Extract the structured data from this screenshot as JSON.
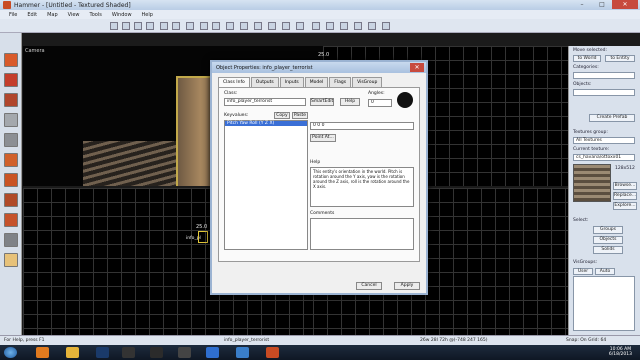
{
  "window": {
    "title": "Hammer - [Untitled - Textured Shaded]"
  },
  "menu": [
    "File",
    "Edit",
    "Map",
    "View",
    "Tools",
    "Window",
    "Help"
  ],
  "viewport3d": {
    "label": "Camera"
  },
  "grid_labels": {
    "top": "25.0",
    "left": "25.0",
    "cursor_tag": "info_pl"
  },
  "sidebar": {
    "move_selected": "Move selected:",
    "to_world": "to World",
    "to_entity": "to Entity",
    "categories_label": "Categories:",
    "objects_label": "Objects:",
    "create_prefab": "Create Prefab",
    "textures_group_label": "Textures group:",
    "textures_group_value": "All Textures",
    "current_texture_label": "Current texture:",
    "current_texture_value": "cs_havana/ottoxx01",
    "texture_size": "128x512",
    "browse": "Browse...",
    "replace": "Replace...",
    "explore": "Explore...",
    "select_label": "Select:",
    "groups": "Groups",
    "objects": "Objects",
    "solids": "Solids",
    "visgroups_label": "VisGroups:",
    "user": "User",
    "auto": "Auto"
  },
  "dialog": {
    "title": "Object Properties: info_player_terrorist",
    "tabs": [
      "Class Info",
      "Outputs",
      "Inputs",
      "Model",
      "Flags",
      "VisGroup"
    ],
    "class_label": "Class:",
    "class_value": "info_player_terrorist",
    "smartedit": "SmartEdit",
    "help_button": "Help",
    "angles_label": "Angles:",
    "angles_value": "0",
    "keyvalues_label": "Keyvalues:",
    "copy": "Copy",
    "paste": "Paste",
    "selected_key": "Pitch Yaw Roll (Y Z X)",
    "value_field": "0 0 0",
    "point_at": "Point At...",
    "help_label": "Help",
    "help_text": "This entity's orientation in the world. Pitch is rotation around the Y axis, yaw is the rotation around the Z axis, roll is the rotation around the X axis.",
    "comments_label": "Comments",
    "cancel": "Cancel",
    "apply": "Apply"
  },
  "status": {
    "help": "For Help, press F1",
    "selection": "info_player_terrorist",
    "size": "26w 28l 72h @(-748 247 165)",
    "snap": "Snap: On Grid: 64"
  },
  "taskbar": {
    "time": "10:06 AM",
    "date": "6/18/2013"
  }
}
